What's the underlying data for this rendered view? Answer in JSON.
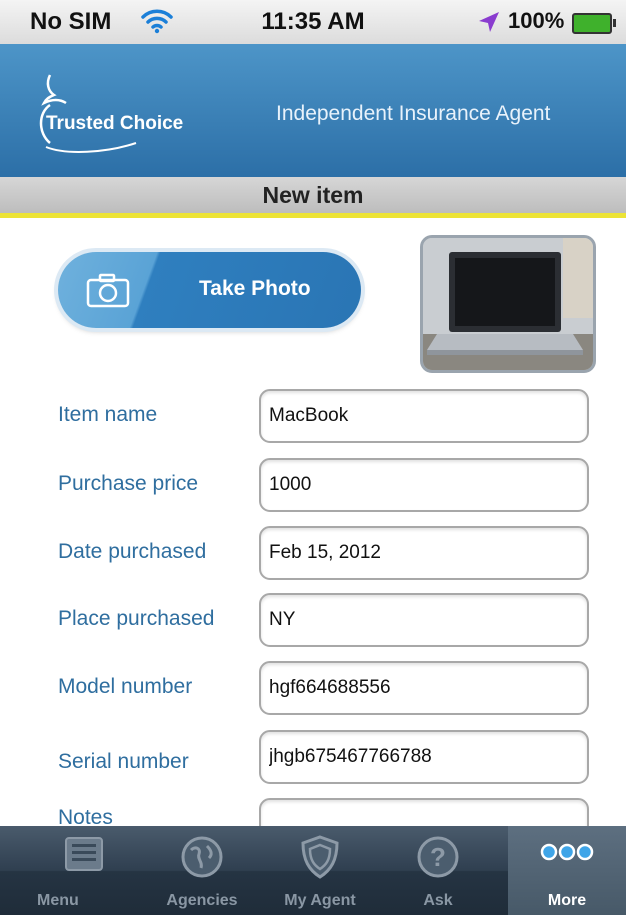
{
  "status_bar": {
    "carrier": "No SIM",
    "time": "11:35 AM",
    "battery": "100%"
  },
  "header": {
    "logo_text": "Trusted Choice",
    "title": "Independent Insurance Agent"
  },
  "page": {
    "title": "New item"
  },
  "photo": {
    "button_label": "Take Photo"
  },
  "form": {
    "fields": [
      {
        "label": "Item name",
        "value": "MacBook"
      },
      {
        "label": "Purchase price",
        "value": "1000"
      },
      {
        "label": "Date purchased",
        "value": "Feb 15, 2012"
      },
      {
        "label": "Place purchased",
        "value": "NY"
      },
      {
        "label": "Model number",
        "value": "hgf664688556"
      },
      {
        "label": "Serial number",
        "value": "jhgb675467766788"
      },
      {
        "label": "Notes",
        "value": ""
      }
    ]
  },
  "tabs": [
    {
      "label": "Menu",
      "icon": "list-icon"
    },
    {
      "label": "Agencies",
      "icon": "globe-icon"
    },
    {
      "label": "My Agent",
      "icon": "shield-icon"
    },
    {
      "label": "Ask",
      "icon": "question-icon"
    },
    {
      "label": "More",
      "icon": "more-dots-icon",
      "active": true
    }
  ],
  "colors": {
    "header_blue": "#3a82bb",
    "label_blue": "#2f6e9f",
    "accent_yellow": "#ece336",
    "tab_bar": "#2f3f50"
  }
}
